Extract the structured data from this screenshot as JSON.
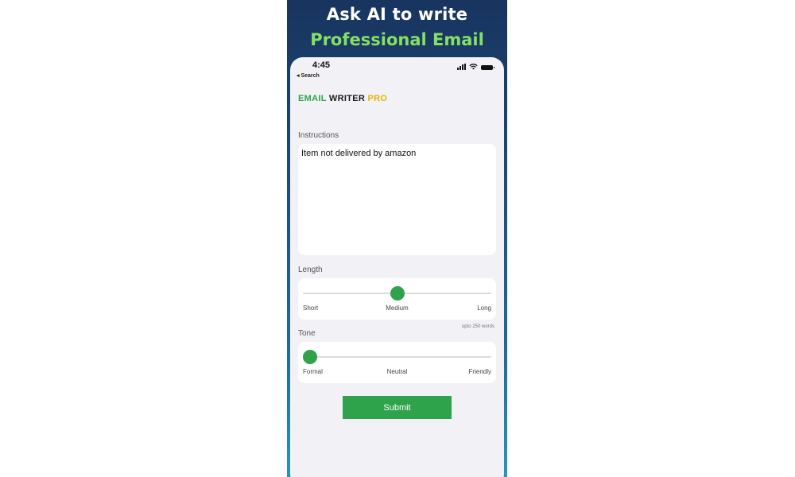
{
  "promo": {
    "headline_line1": "Ask AI to write",
    "headline_line2": "Professional Email"
  },
  "colors": {
    "accent_green": "#2fa34b",
    "headline_green": "#86e063",
    "title_yellow": "#e9b400",
    "banner_dark": "#18345f"
  },
  "status_bar": {
    "time": "4:45",
    "back_label": "◂ Search",
    "icons": [
      "signal-icon",
      "wifi-icon",
      "battery-icon"
    ]
  },
  "app": {
    "title_part1": "EMAIL",
    "title_part2": "WRITER",
    "title_part3": "PRO"
  },
  "form": {
    "instructions_label": "Instructions",
    "instructions_value": "Item not delivered by amazon",
    "length": {
      "label": "Length",
      "options": [
        "Short",
        "Medium",
        "Long"
      ],
      "selected": "Medium",
      "level": 0.5,
      "hint": "upto 250 words"
    },
    "tone": {
      "label": "Tone",
      "options": [
        "Formal",
        "Neutral",
        "Friendly"
      ],
      "selected": "Formal",
      "level": 0.0
    },
    "submit_label": "Submit"
  }
}
